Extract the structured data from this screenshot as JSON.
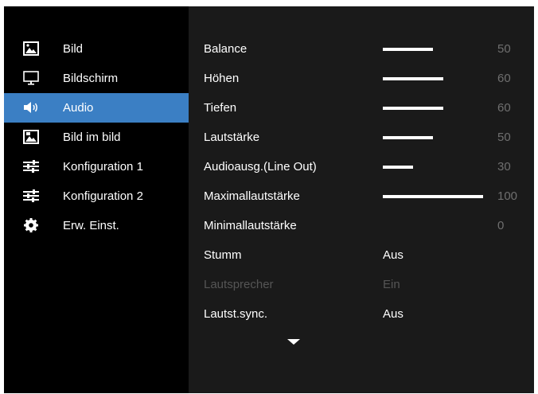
{
  "sidebar": {
    "items": [
      {
        "label": "Bild",
        "icon": "picture-icon",
        "selected": false
      },
      {
        "label": "Bildschirm",
        "icon": "monitor-icon",
        "selected": false
      },
      {
        "label": "Audio",
        "icon": "speaker-icon",
        "selected": true
      },
      {
        "label": "Bild im bild",
        "icon": "picture-in-picture-icon",
        "selected": false
      },
      {
        "label": "Konfiguration 1",
        "icon": "sliders-icon",
        "selected": false
      },
      {
        "label": "Konfiguration 2",
        "icon": "sliders-icon",
        "selected": false
      },
      {
        "label": "Erw. Einst.",
        "icon": "gear-icon",
        "selected": false
      }
    ]
  },
  "settings": {
    "rows": [
      {
        "label": "Balance",
        "level": 50,
        "display": "50",
        "enabled": true
      },
      {
        "label": "Höhen",
        "level": 60,
        "display": "60",
        "enabled": true
      },
      {
        "label": "Tiefen",
        "level": 60,
        "display": "60",
        "enabled": true
      },
      {
        "label": "Lautstärke",
        "level": 50,
        "display": "50",
        "enabled": true
      },
      {
        "label": "Audioausg.(Line Out)",
        "level": 30,
        "display": "30",
        "enabled": true
      },
      {
        "label": "Maximallautstärke",
        "level": 100,
        "display": "100",
        "enabled": true
      },
      {
        "label": "Minimallautstärke",
        "level": 0,
        "display": "0",
        "enabled": true
      },
      {
        "label": "Stumm",
        "value": "Aus",
        "enabled": true
      },
      {
        "label": "Lautsprecher",
        "value": "Ein",
        "enabled": false
      },
      {
        "label": "Lautst.sync.",
        "value": "Aus",
        "enabled": true
      }
    ],
    "more_indicator_icon": "chevron-down-icon"
  },
  "colors": {
    "selected": "#3b7fc4",
    "panel": "#1a1a1a",
    "background": "#000000",
    "disabled_text": "#555555",
    "level_text": "#6f6f6f"
  }
}
